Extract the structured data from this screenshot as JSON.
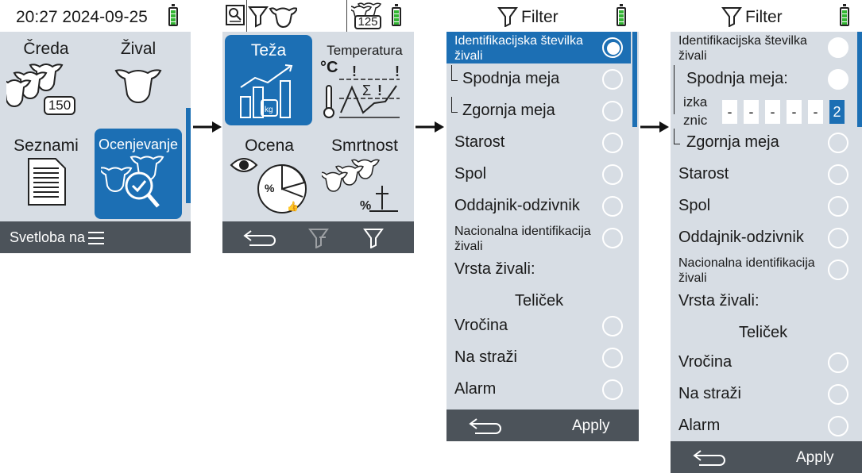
{
  "screen1": {
    "datetime": "20:27 2024-09-25",
    "tiles": {
      "herd": "Čreda",
      "animal": "Žival",
      "lists": "Seznami",
      "evaluation": "Ocenjevanje"
    },
    "herd_count": "150",
    "footer_label": "Svetloba na"
  },
  "screen2": {
    "count_badge": "125",
    "tiles": {
      "weight": "Teža",
      "temperature": "Temperatura",
      "score": "Ocena",
      "mortality": "Smrtnost"
    },
    "temp_unit": "°C",
    "kg_label": "kg"
  },
  "screen3": {
    "title": "Filter",
    "rows": [
      "Identifikacijska številka živali",
      "Spodnja meja",
      "Zgornja meja",
      "Starost",
      "Spol",
      "Oddajnik-odzivnik",
      "Nacionalna identifikacija živali",
      "Vrsta živali:",
      "Teliček",
      "Vročina",
      "Na straži",
      "Alarm"
    ],
    "apply": "Apply"
  },
  "screen4": {
    "title": "Filter",
    "rows": {
      "id": "Identifikacijska številka živali",
      "lower": "Spodnja meja:",
      "selection_line1": "izka",
      "selection_line2": "znic",
      "upper": "Zgornja meja",
      "age": "Starost",
      "sex": "Spol",
      "transponder": "Oddajnik-odzivnik",
      "national": "Nacionalna identifikacija živali",
      "type": "Vrsta živali:",
      "calf": "Teliček",
      "fever": "Vročina",
      "on_guard": "Na straži",
      "alarm": "Alarm"
    },
    "digits": [
      "-",
      "-",
      "-",
      "-",
      "-",
      "2"
    ],
    "apply": "Apply"
  },
  "colors": {
    "accent": "#1c6fb4",
    "panel": "#d7dde4",
    "footer": "#4c535a",
    "battery": "#33b533"
  }
}
